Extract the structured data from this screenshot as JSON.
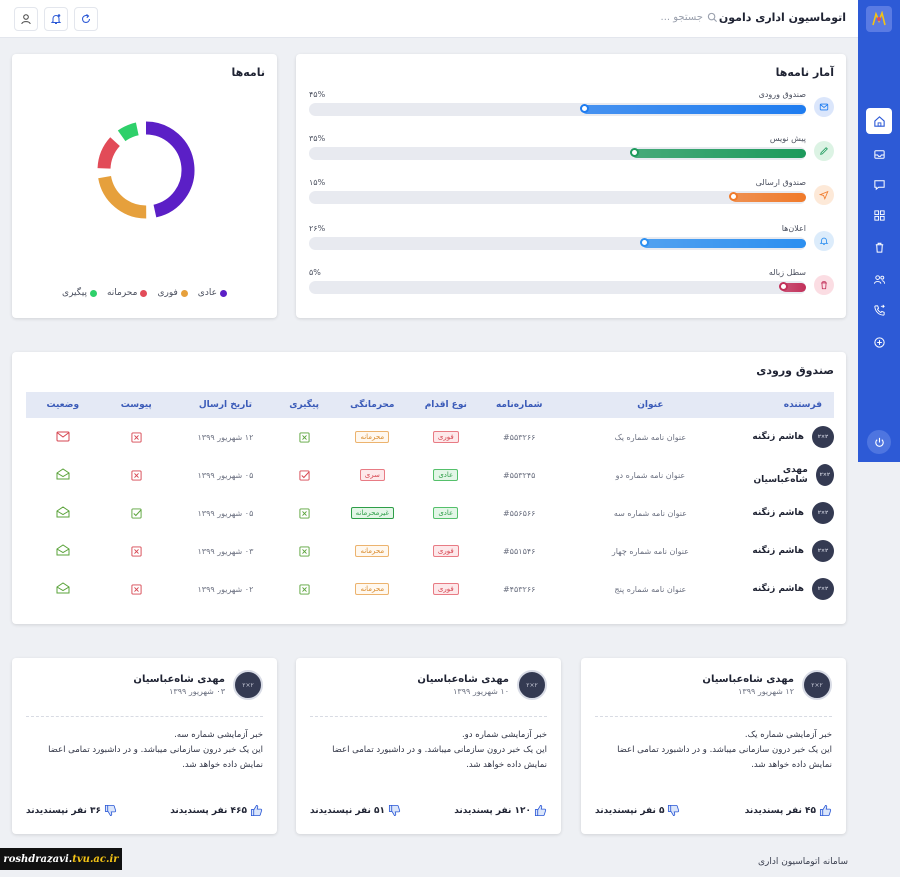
{
  "header": {
    "app_title": "اتوماسیون اداری دامون",
    "search_placeholder": "جستجو ..."
  },
  "stats": {
    "title": "آمار نامه‌ها",
    "items": [
      {
        "label": "صندوق ورودی",
        "percent_label": "۴۵%",
        "percent": 45,
        "color": "#1e7cf0",
        "icon": "mail-icon",
        "bg": "#dbe6fb"
      },
      {
        "label": "پیش نویس",
        "percent_label": "۳۵%",
        "percent": 35,
        "color": "#1d9a5c",
        "icon": "pen-icon",
        "bg": "#dcf3e4"
      },
      {
        "label": "صندوق ارسالی",
        "percent_label": "۱۵%",
        "percent": 15,
        "color": "#f07a2a",
        "icon": "send-icon",
        "bg": "#fde9d8"
      },
      {
        "label": "اعلان‌ها",
        "percent_label": "۲۶%",
        "percent": 33,
        "color": "#2c8ff0",
        "icon": "bell-icon",
        "bg": "#dcecfb"
      },
      {
        "label": "سطل زباله",
        "percent_label": "۵%",
        "percent": 5,
        "color": "#c2305a",
        "icon": "trash-icon",
        "bg": "#fbdde3"
      }
    ]
  },
  "letters_chart": {
    "title": "نامه‌ها",
    "chart_data": {
      "type": "pie",
      "categories": [
        "عادی",
        "فوری",
        "محرمانه",
        "پیگیری"
      ],
      "values": [
        50,
        24,
        12,
        7
      ],
      "colors": [
        "#5b1fc6",
        "#e6a03c",
        "#e24b58",
        "#2ed06a"
      ],
      "title": "نامه‌ها"
    }
  },
  "inbox": {
    "title": "صندوق ورودی",
    "columns": [
      "فرستنده",
      "عنوان",
      "شماره‌نامه",
      "نوع اقدام",
      "محرمانگی",
      "پیگیری",
      "تاریخ ارسال",
      "پیوست",
      "وضعیت"
    ],
    "rows": [
      {
        "sender": "هاشم زنگنه",
        "subject": "عنوان نامه شماره یک",
        "number": "#۵۵۳۲۶۶",
        "action": "فوری",
        "action_style": "b-red",
        "confidentiality": "محرمانه",
        "conf_style": "b-orange",
        "followup": "x",
        "date": "۱۲ شهریور ۱۳۹۹",
        "attachment": "x",
        "status": "unread"
      },
      {
        "sender": "مهدی شاه‌عباسیان",
        "subject": "عنوان نامه شماره دو",
        "number": "#۵۵۳۲۴۵",
        "action": "عادی",
        "action_style": "b-green",
        "confidentiality": "سری",
        "conf_style": "b-red",
        "followup": "check-red",
        "date": "۰۵ شهریور ۱۳۹۹",
        "attachment": "x",
        "status": "read"
      },
      {
        "sender": "هاشم زنگنه",
        "subject": "عنوان نامه شماره سه",
        "number": "#۵۵۶۵۶۶",
        "action": "عادی",
        "action_style": "b-green",
        "confidentiality": "غیرمحرمانه",
        "conf_style": "b-green-solid",
        "followup": "x",
        "date": "۰۵ شهریور ۱۳۹۹",
        "attachment": "check-green",
        "status": "read"
      },
      {
        "sender": "هاشم زنگنه",
        "subject": "عنوان نامه شماره چهار",
        "number": "#۵۵۱۵۴۶",
        "action": "فوری",
        "action_style": "b-red",
        "confidentiality": "محرمانه",
        "conf_style": "b-orange",
        "followup": "x",
        "date": "۰۳ شهریور ۱۳۹۹",
        "attachment": "x",
        "status": "read"
      },
      {
        "sender": "هاشم زنگنه",
        "subject": "عنوان نامه شماره پنج",
        "number": "#۴۵۳۲۶۶",
        "action": "فوری",
        "action_style": "b-red",
        "confidentiality": "محرمانه",
        "conf_style": "b-orange",
        "followup": "x",
        "date": "۰۲ شهریور ۱۳۹۹",
        "attachment": "x",
        "status": "read"
      }
    ],
    "avatar_text": "۲×۲"
  },
  "news": [
    {
      "name": "مهدی شاه‌عباسیان",
      "date": "۱۲ شهریور ۱۳۹۹",
      "line1": "خبر آزمایشی شماره یک.",
      "line2": "این یک خبر درون سازمانی میباشد. و در داشبورد تمامی اعضا نمایش داده خواهد شد.",
      "likes": "۴۵ نفر پسندیدند",
      "dislikes": "۵ نفر نپسندیدند"
    },
    {
      "name": "مهدی شاه‌عباسیان",
      "date": "۱۰ شهریور ۱۳۹۹",
      "line1": "خبر آزمایشی شماره دو.",
      "line2": "این یک خبر درون سازمانی میباشد. و در داشبورد تمامی اعضا نمایش داده خواهد شد.",
      "likes": "۱۲۰ نفر پسندیدند",
      "dislikes": "۵۱ نفر نپسندیدند"
    },
    {
      "name": "مهدی شاه‌عباسیان",
      "date": "۰۳ شهریور ۱۳۹۹",
      "line1": "خبر آزمایشی شماره سه.",
      "line2": "این یک خبر درون سازمانی میباشد. و در داشبورد تمامی اعضا نمایش داده خواهد شد.",
      "likes": "۴۶۵ نفر پسندیدند",
      "dislikes": "۳۶ نفر نپسندیدند"
    }
  ],
  "footer": {
    "text": "سامانه اتوماسیون اداری",
    "watermark_a": "roshdrazavi.",
    "watermark_b": "tvu.ac.ir"
  }
}
